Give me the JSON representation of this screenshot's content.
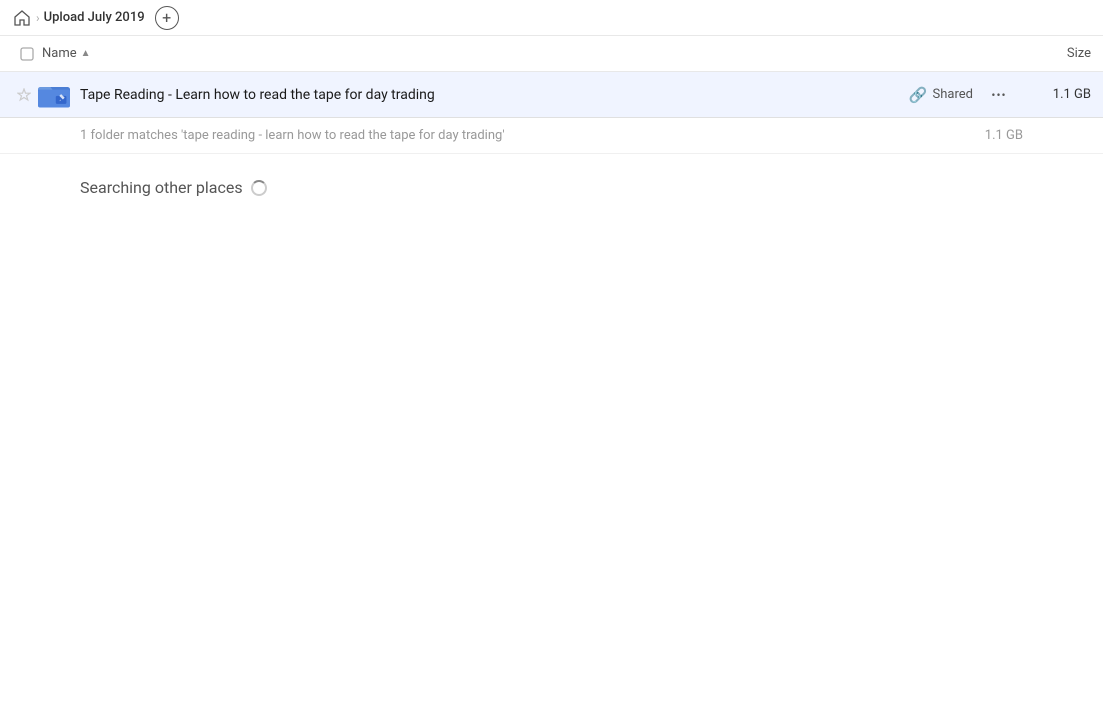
{
  "header": {
    "home_title": "Home",
    "breadcrumb_title": "Upload July 2019",
    "add_button_label": "+"
  },
  "columns": {
    "name_label": "Name",
    "sort_indicator": "▲",
    "size_label": "Size"
  },
  "file_row": {
    "name": "Tape Reading - Learn how to read the tape for day trading",
    "shared_label": "Shared",
    "size": "1.1 GB",
    "more_icon": "•••"
  },
  "match_row": {
    "text": "1 folder matches 'tape reading - learn how to read the tape for day trading'",
    "size": "1.1 GB"
  },
  "searching": {
    "label": "Searching other places"
  },
  "colors": {
    "accent": "#4285f4",
    "row_bg": "#eef2ff"
  }
}
